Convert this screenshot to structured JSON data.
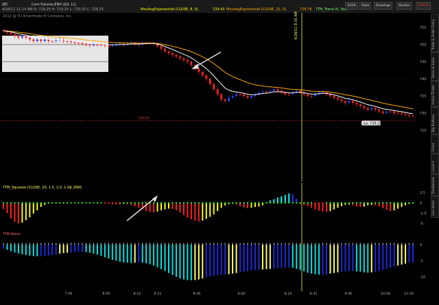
{
  "header": {
    "symbol": "/ZC",
    "symbol_desc": "Corn Futures,ENH (JUL 11)",
    "info": "4/28/11 11:14 AM  O: 729.25  H: 729.25  L: 729.25  C: 729.25",
    "ma8_label": "MovAvgExponential (CLOSE, 8, 0)",
    "ma8_value": "729.43",
    "ma21_label": "MovAvgExponential (CLOSE, 21, 0)",
    "ma21_value": "729.76",
    "trend_label": "TTM_Trend (6, Yes)",
    "copyright": "2010 @ TD Ameritrade IP Company, Inc.",
    "zoom": "333%",
    "style_btn": "Style",
    "drawings_btn": "Drawings",
    "studies_btn": "Studies",
    "last_price": "729.25"
  },
  "sidebar": [
    "Trade & Order Entry",
    "Times & Sales",
    "Active Trader",
    "Big Buttons",
    "Chart",
    "Level II",
    "Dashboard",
    "Live News"
  ],
  "squeeze_label": "TTM_Squeeze (CLOSE, 20, 1.5, 2.0, 1.0)",
  "squeeze_value": "-1.2685",
  "wave_label": "TTM Wave",
  "date_marker": "4/28/11 8:31 AM",
  "level_price": "729.50",
  "price_badge": "Lo: 729.25",
  "colors": {
    "up": "#2244ff",
    "down": "#ff2222",
    "ema8": "#ffffff",
    "ema21": "#ffaa00",
    "sq_up": "#00ffff",
    "sq_up2": "#2233ff",
    "sq_dn": "#ff2222",
    "sq_dn2": "#ffff00"
  },
  "chart_data": {
    "type": "candlestick",
    "price_axis": {
      "ticks": [
        "755",
        "750",
        "745",
        "740",
        "735",
        "730",
        "725"
      ],
      "ylim": [
        722,
        757
      ]
    },
    "time_axis": {
      "ticks": [
        "7:45",
        "8:00",
        "8:15",
        "8:31",
        "8:45",
        "9:00",
        "9:15",
        "9:31",
        "9:45",
        "10:00",
        "11:02"
      ]
    },
    "squeeze_axis": {
      "ticks": [
        "2.5",
        "0",
        "-2.5",
        "-5"
      ],
      "ylim": [
        -6,
        3
      ]
    },
    "wave_axis": {
      "ticks": [
        "0",
        "-5",
        "-10"
      ],
      "ylim": [
        -13,
        1.5
      ]
    },
    "close": [
      754.0,
      753.5,
      753.0,
      752.5,
      752.0,
      752.5,
      752.0,
      751.5,
      751.0,
      751.5,
      751.0,
      751.5,
      751.0,
      751.0,
      751.25,
      751.5,
      751.0,
      751.0,
      750.75,
      750.5,
      750.5,
      750.25,
      750.0,
      749.75,
      750.0,
      750.0,
      750.0,
      749.75,
      749.5,
      749.75,
      750.0,
      750.25,
      750.0,
      750.25,
      750.5,
      750.25,
      750.0,
      750.5,
      750.5,
      750.5,
      750.25,
      749.5,
      748.75,
      748.0,
      747.5,
      747.0,
      746.5,
      746.0,
      745.5,
      745.0,
      744.0,
      743.0,
      742.0,
      741.0,
      740.0,
      738.5,
      737.0,
      735.5,
      734.0,
      733.5,
      734.5,
      735.0,
      735.5,
      735.5,
      735.0,
      734.5,
      735.0,
      735.5,
      736.0,
      736.25,
      736.25,
      736.5,
      737.0,
      736.5,
      736.0,
      735.5,
      735.5,
      736.0,
      736.5,
      736.0,
      735.5,
      735.0,
      735.0,
      735.5,
      736.0,
      736.25,
      735.5,
      735.0,
      734.5,
      734.0,
      733.5,
      733.0,
      733.5,
      733.0,
      732.5,
      732.0,
      731.5,
      731.0,
      731.5,
      731.0,
      730.5,
      730.0,
      730.5,
      730.5,
      730.0,
      730.0,
      729.75,
      729.5,
      729.25,
      729.25
    ],
    "squeeze_momentum": [
      -1.5,
      -2.5,
      -3.8,
      -4.6,
      -5.0,
      -4.8,
      -4.2,
      -3.5,
      -2.6,
      -1.8,
      -1.0,
      -0.5,
      -0.2,
      -0.1,
      -0.05,
      -0.1,
      -0.2,
      -0.15,
      -0.1,
      -0.05,
      0.0,
      0.05,
      0.1,
      0.15,
      0.1,
      0.05,
      0.0,
      -0.1,
      -0.2,
      -0.3,
      -0.35,
      -0.3,
      -0.25,
      -0.3,
      -0.5,
      -0.8,
      -1.2,
      -1.6,
      -2.0,
      -2.2,
      -2.3,
      -2.1,
      -1.8,
      -1.6,
      -1.4,
      -1.5,
      -1.8,
      -2.3,
      -3.0,
      -3.6,
      -4.0,
      -4.3,
      -4.5,
      -4.3,
      -3.9,
      -3.4,
      -2.8,
      -2.0,
      -1.2,
      -0.6,
      -0.3,
      -0.2,
      -0.4,
      -0.8,
      -1.1,
      -1.3,
      -1.2,
      -1.0,
      -0.9,
      -0.6,
      0.2,
      0.6,
      0.9,
      1.3,
      1.6,
      1.9,
      2.3,
      2.1,
      1.0,
      -0.3,
      -0.5,
      -0.8,
      -1.2,
      -1.6,
      -1.9,
      -2.1,
      -2.2,
      -2.0,
      -1.6,
      -1.2,
      -0.8,
      -0.5,
      -0.4,
      -0.6,
      -0.9,
      -1.0,
      -0.9,
      -0.6,
      -0.5,
      -0.6,
      -0.9,
      -1.3,
      -1.7,
      -2.0,
      -1.8,
      -1.4,
      -1.0,
      -0.6,
      -0.3,
      -0.2
    ],
    "wave": [
      -1.2,
      -1.6,
      -2.0,
      -2.4,
      -2.7,
      -3.0,
      -3.2,
      -3.4,
      -3.5,
      -3.6,
      -3.6,
      -3.5,
      -3.4,
      -3.2,
      -3.0,
      -2.8,
      -2.6,
      -2.5,
      -2.4,
      -2.3,
      -2.2,
      -2.2,
      -2.3,
      -2.5,
      -2.8,
      -3.1,
      -3.5,
      -3.9,
      -4.3,
      -4.7,
      -5.0,
      -5.3,
      -5.5,
      -5.6,
      -5.7,
      -5.6,
      -5.5,
      -5.6,
      -5.8,
      -6.1,
      -6.5,
      -7.0,
      -7.6,
      -8.2,
      -8.8,
      -9.4,
      -10.0,
      -10.5,
      -10.8,
      -11.0,
      -11.1,
      -11.0,
      -10.8,
      -10.5,
      -10.2,
      -9.9,
      -9.7,
      -9.5,
      -9.4,
      -9.3,
      -9.2,
      -9.0,
      -8.8,
      -8.6,
      -8.4,
      -8.2,
      -8.0,
      -7.9,
      -7.8,
      -7.7,
      -7.6,
      -7.5,
      -7.4,
      -7.3,
      -7.2,
      -7.1,
      -7.1,
      -7.2,
      -7.5,
      -7.9,
      -8.3,
      -8.7,
      -9.0,
      -9.2,
      -9.3,
      -9.3,
      -9.2,
      -9.0,
      -8.8,
      -8.6,
      -8.4,
      -8.3,
      -8.2,
      -8.2,
      -8.3,
      -8.4,
      -8.6,
      -8.7,
      -8.6,
      -8.4,
      -8.1,
      -7.8,
      -7.5,
      -7.2,
      -6.8,
      -6.5,
      -6.2,
      -5.9,
      -5.6,
      -5.4
    ]
  }
}
